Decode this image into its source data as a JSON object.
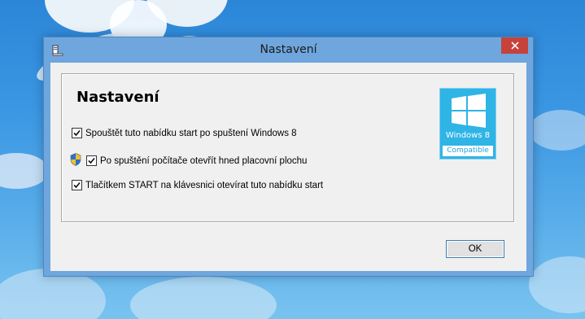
{
  "window": {
    "title": "Nastavení"
  },
  "content": {
    "heading": "Nastavení",
    "options": [
      {
        "label": "Spouštět tuto nabídku start po spuštení Windows 8",
        "checked": true
      },
      {
        "label": "Po spuštění počítače otevřít hned placovní plochu",
        "checked": true,
        "icon": "uac-shield-icon"
      },
      {
        "label": "Tlačítkem START na klávesnici otevírat tuto nabídku start",
        "checked": true
      }
    ],
    "logo": {
      "name": "Windows 8",
      "badge": "Compatible"
    },
    "ok_label": "OK"
  },
  "colors": {
    "titlebar": "#6fa6dd",
    "close": "#c7423a",
    "logo": "#2fb4e6",
    "dialog_bg": "#f0f0f0"
  }
}
